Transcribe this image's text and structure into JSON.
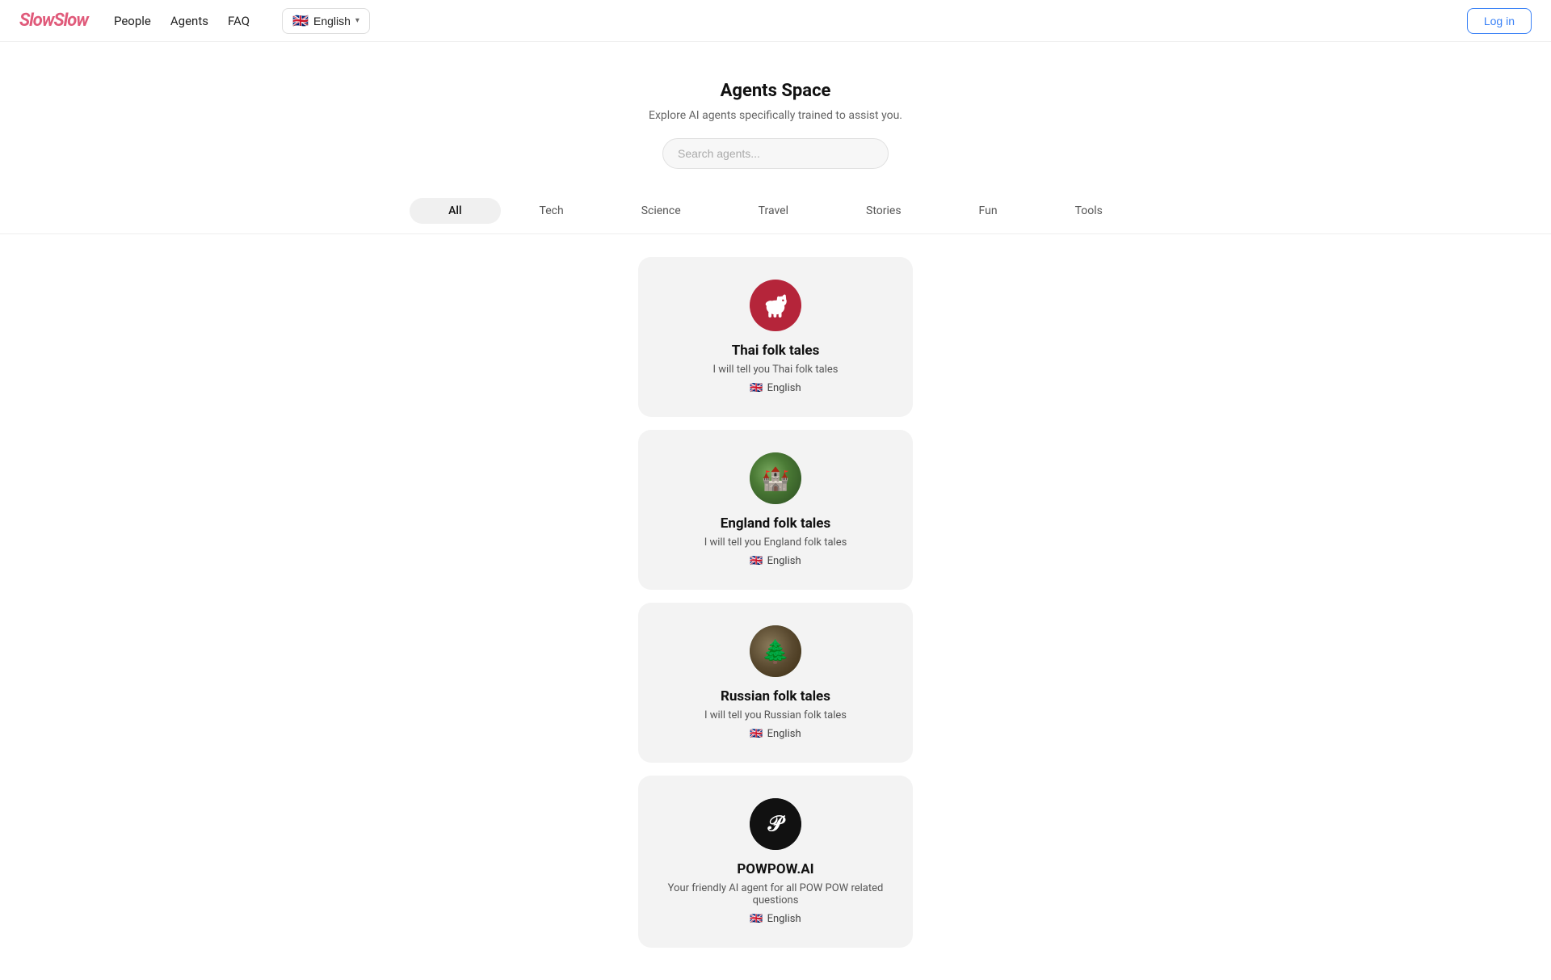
{
  "app": {
    "logo": "SlowSlow"
  },
  "navbar": {
    "people_label": "People",
    "agents_label": "Agents",
    "faq_label": "FAQ",
    "language_label": "English",
    "flag_emoji": "🇬🇧",
    "login_label": "Log in"
  },
  "hero": {
    "title": "Agents Space",
    "subtitle": "Explore AI agents specifically trained to assist you.",
    "search_placeholder": "Search agents..."
  },
  "categories": [
    {
      "id": "all",
      "label": "All",
      "active": true
    },
    {
      "id": "tech",
      "label": "Tech",
      "active": false
    },
    {
      "id": "science",
      "label": "Science",
      "active": false
    },
    {
      "id": "travel",
      "label": "Travel",
      "active": false
    },
    {
      "id": "stories",
      "label": "Stories",
      "active": false
    },
    {
      "id": "fun",
      "label": "Fun",
      "active": false
    },
    {
      "id": "tools",
      "label": "Tools",
      "active": false
    }
  ],
  "agents": [
    {
      "id": "thai-folk-tales",
      "name": "Thai folk tales",
      "description": "I will tell you Thai folk tales",
      "language_flag": "🇬🇧",
      "language": "English",
      "avatar_type": "thai"
    },
    {
      "id": "england-folk-tales",
      "name": "England folk tales",
      "description": "I will tell you England folk tales",
      "language_flag": "🇬🇧",
      "language": "English",
      "avatar_type": "england"
    },
    {
      "id": "russian-folk-tales",
      "name": "Russian folk tales",
      "description": "I will tell you Russian folk tales",
      "language_flag": "🇬🇧",
      "language": "English",
      "avatar_type": "russian"
    },
    {
      "id": "powpow-ai",
      "name": "POWPOW.AI",
      "description": "Your friendly AI agent for all POW POW related questions",
      "language_flag": "🇬🇧",
      "language": "English",
      "avatar_type": "powpow"
    }
  ]
}
